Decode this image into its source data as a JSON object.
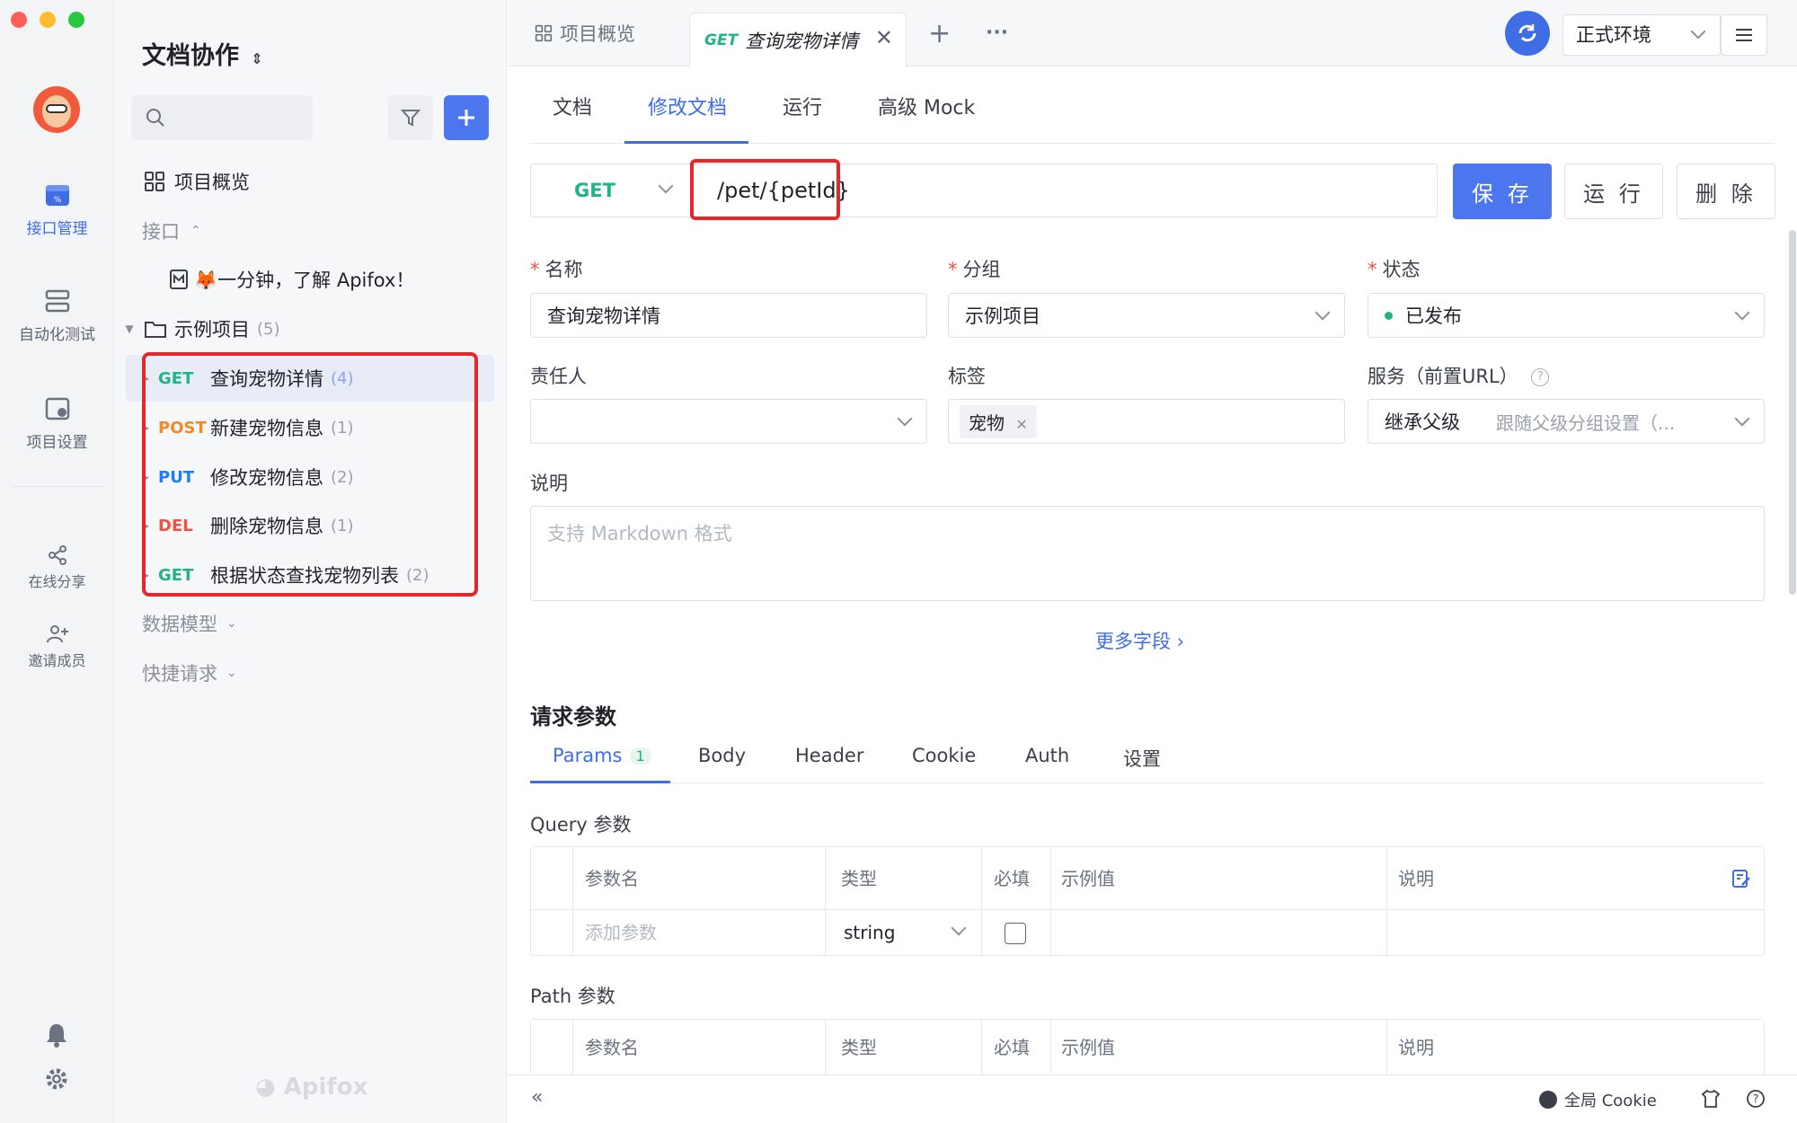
{
  "rail": {
    "items": [
      {
        "label": "接口管理",
        "icon": "api-management-icon"
      },
      {
        "label": "自动化测试",
        "icon": "automation-test-icon"
      },
      {
        "label": "项目设置",
        "icon": "project-settings-icon"
      },
      {
        "label": "在线分享",
        "icon": "share-icon"
      },
      {
        "label": "邀请成员",
        "icon": "invite-member-icon"
      }
    ],
    "bottom_icons": [
      "bell-icon",
      "gear-icon"
    ]
  },
  "tree": {
    "project_title": "文档协作",
    "overview_label": "项目概览",
    "section_interface": "接口",
    "intro_doc": "🦊一分钟，了解 Apifox！",
    "folder": {
      "name": "示例项目",
      "count": "(5)"
    },
    "endpoints": [
      {
        "method": "GET",
        "name": "查询宠物详情",
        "count": "(4)"
      },
      {
        "method": "POST",
        "name": "新建宠物信息",
        "count": "(1)"
      },
      {
        "method": "PUT",
        "name": "修改宠物信息",
        "count": "(2)"
      },
      {
        "method": "DEL",
        "name": "删除宠物信息",
        "count": "(1)"
      },
      {
        "method": "GET",
        "name": "根据状态查找宠物列表",
        "count": "(2)"
      }
    ],
    "section_models": "数据模型",
    "section_quick": "快捷请求",
    "watermark": "Apifox"
  },
  "tabs": {
    "overview": "项目概览",
    "active_method": "GET",
    "active_name": "查询宠物详情",
    "add": "+",
    "more": "···",
    "environment": "正式环境"
  },
  "subtabs": [
    "文档",
    "修改文档",
    "运行",
    "高级 Mock"
  ],
  "request": {
    "method": "GET",
    "path": "/pet/{petId}",
    "save": "保 存",
    "run": "运 行",
    "delete": "删 除"
  },
  "form": {
    "name_label": "名称",
    "name_value": "查询宠物详情",
    "group_label": "分组",
    "group_value": "示例项目",
    "status_label": "状态",
    "status_value": "已发布",
    "owner_label": "责任人",
    "tags_label": "标签",
    "tag_value": "宠物",
    "service_label": "服务（前置URL）",
    "service_value": "继承父级",
    "service_hint": "跟随父级分组设置（...",
    "desc_label": "说明",
    "desc_placeholder": "支持 Markdown 格式",
    "more_fields": "更多字段 ›"
  },
  "params": {
    "section_title": "请求参数",
    "tabs": [
      "Params",
      "Body",
      "Header",
      "Cookie",
      "Auth",
      "设置"
    ],
    "params_count": "1",
    "query_title": "Query 参数",
    "path_title": "Path 参数",
    "columns": [
      "参数名",
      "类型",
      "必填",
      "示例值",
      "说明"
    ],
    "add_placeholder": "添加参数",
    "type_value": "string"
  },
  "footer": {
    "global_cookie": "全局 Cookie"
  },
  "colors": {
    "accent": "#3e6de6",
    "get": "#1fb484",
    "post": "#f08a24",
    "put": "#1e7df0",
    "del": "#ee5242",
    "highlight_box": "#e5262b"
  }
}
